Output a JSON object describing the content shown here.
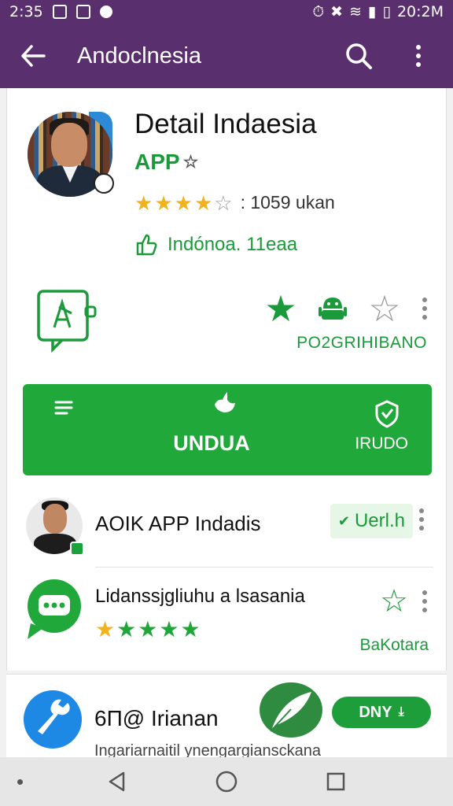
{
  "status_bar": {
    "time_left": "2:35",
    "time_right": "20:2M"
  },
  "app_bar": {
    "title": "Andoclnesia"
  },
  "app": {
    "title": "Detail Indaesia",
    "tag": "APP",
    "rating": 4,
    "rating_count": ": 1059 ukan",
    "vendor": "Indónoa. 11eaa",
    "action_label": "PO2GRIHIBANO"
  },
  "install_button": {
    "main_label": "UNDUA",
    "side_label": "IRUDO"
  },
  "list": [
    {
      "name": "AOIK APP Indadis",
      "badge": "Uerl.h"
    },
    {
      "name": "Lidanssjgliuhu a lsasania",
      "stars": 5,
      "action_label": "BaKotara"
    }
  ],
  "lower_card": {
    "title": "6Π@ Irianan",
    "subtitle": "Ingariarnaitil ynengargiansckana",
    "button_label": "DNY"
  },
  "colors": {
    "brand_purple": "#5a2f6d",
    "accent_green": "#20a83a",
    "star_gold": "#f2b21b"
  }
}
